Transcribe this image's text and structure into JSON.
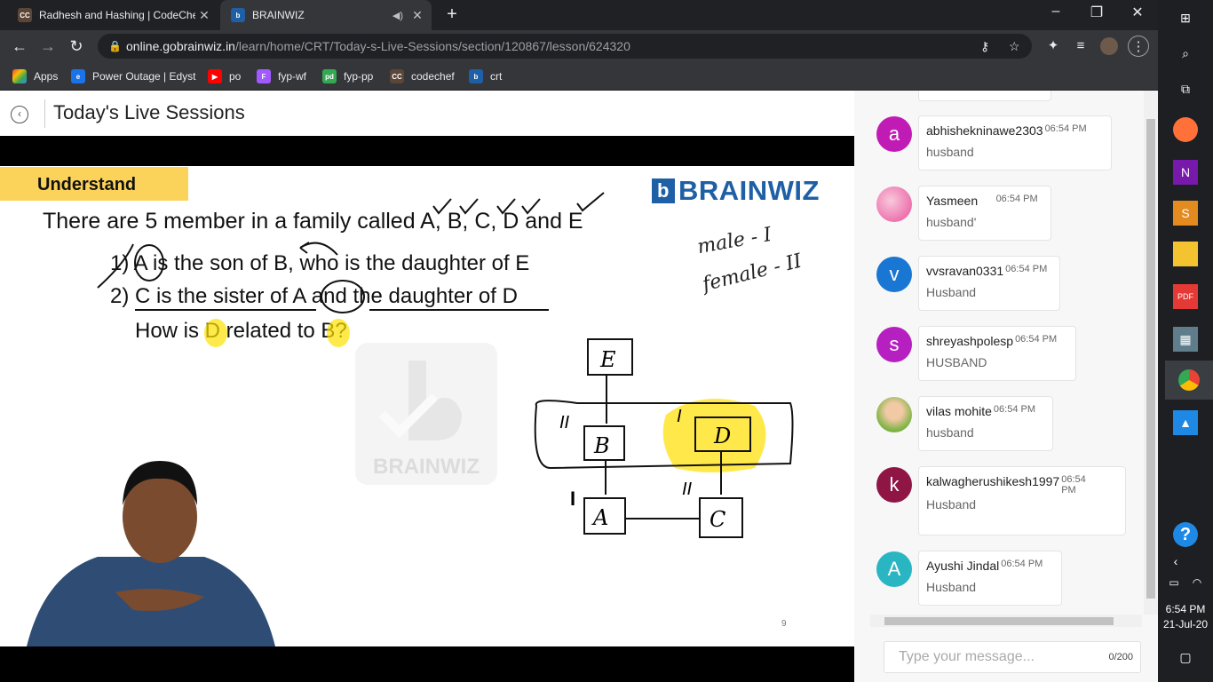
{
  "browser": {
    "tabs": [
      {
        "title": "Radhesh and Hashing | CodeChef",
        "favicon": "CC",
        "active": false
      },
      {
        "title": "BRAINWIZ",
        "favicon": "b",
        "active": true
      }
    ],
    "url_host": "online.gobrainwiz.in",
    "url_path": "/learn/home/CRT/Today-s-Live-Sessions/section/120867/lesson/624320",
    "bookmarks": [
      {
        "label": "Apps",
        "icon": "apps-grid-icon",
        "color": "#4285f4"
      },
      {
        "label": "Power Outage | Edyst",
        "icon": "e",
        "color": "#1a73e8"
      },
      {
        "label": "po",
        "icon": "▶",
        "color": "#ff0000"
      },
      {
        "label": "fyp-wf",
        "icon": "F",
        "color": "#a259ff"
      },
      {
        "label": "fyp-pp",
        "icon": "pd",
        "color": "#34a853"
      },
      {
        "label": "codechef",
        "icon": "CC",
        "color": "#5b4638"
      },
      {
        "label": "crt",
        "icon": "b",
        "color": "#1f5fa6"
      }
    ]
  },
  "page": {
    "title": "Today's Live Sessions"
  },
  "slide": {
    "badge": "Understand",
    "brand": "BRAINWIZ",
    "question": "There are 5 member in a family called A, B, C, D and E",
    "statement1": "1) A is the son of B, who is the daughter of E",
    "statement2": "2) C is the sister of A and the daughter of D",
    "statement3": "How is D related to B?",
    "note_male": "male - I",
    "note_female": "female - II",
    "watermark": "BRAINWIZ",
    "slide_number": "9",
    "diagram": {
      "nodes": [
        "E",
        "B",
        "D",
        "A",
        "C"
      ],
      "marks": [
        "II",
        "I",
        "I",
        "II"
      ]
    }
  },
  "chat": {
    "messages": [
      {
        "user": "abhishekninawe2303",
        "time": "06:54 PM",
        "text": "husband",
        "avatar": "a",
        "color": "#c11bb5"
      },
      {
        "user": "Yasmeen",
        "time": "06:54 PM",
        "text": "husband'",
        "avatar": "",
        "color": "#e94f9b"
      },
      {
        "user": "vvsravan0331",
        "time": "06:54 PM",
        "text": "Husband",
        "avatar": "v",
        "color": "#1976d2"
      },
      {
        "user": "shreyashpolesp",
        "time": "06:54 PM",
        "text": "HUSBAND",
        "avatar": "s",
        "color": "#b620c1"
      },
      {
        "user": "vilas mohite",
        "time": "06:54 PM",
        "text": "husband",
        "avatar": "",
        "color": "#7cb342"
      },
      {
        "user": "kalwagherushikesh1997",
        "time": "06:54 PM",
        "text": "Husband",
        "avatar": "k",
        "color": "#8e1544"
      },
      {
        "user": "Ayushi Jindal",
        "time": "06:54 PM",
        "text": "Husband",
        "avatar": "A",
        "color": "#29b6c2"
      }
    ],
    "input_placeholder": "Type your message...",
    "char_count": "0/200"
  },
  "taskbar": {
    "time": "6:54 PM",
    "date": "21-Jul-20"
  }
}
